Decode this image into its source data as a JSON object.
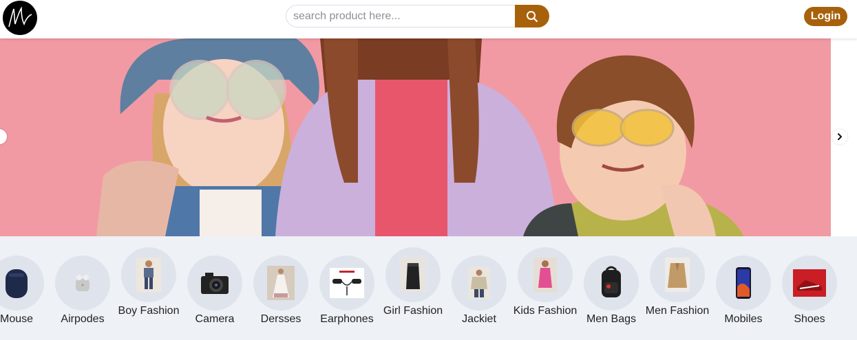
{
  "header": {
    "logo_icon": "signature-logo-icon",
    "search": {
      "placeholder": "search product here...",
      "value": "",
      "button_icon": "search-icon"
    },
    "login_label": "Login",
    "accent_color": "#a8610b"
  },
  "banner": {
    "image": "kids-fashion-banner-photo",
    "background_color": "#f29aa3",
    "prev_icon": "chevron-left-icon",
    "next_icon": "chevron-right-icon"
  },
  "categories": [
    {
      "label": "Mouse",
      "icon": "mouse-product-icon"
    },
    {
      "label": "Airpodes",
      "icon": "airpods-product-icon"
    },
    {
      "label": "Boy Fashion",
      "icon": "boy-fashion-product-icon"
    },
    {
      "label": "Camera",
      "icon": "camera-product-icon"
    },
    {
      "label": "Dersses",
      "icon": "dress-product-icon"
    },
    {
      "label": "Earphones",
      "icon": "earphones-product-icon"
    },
    {
      "label": "Girl Fashion",
      "icon": "girl-fashion-product-icon"
    },
    {
      "label": "Jackiet",
      "icon": "jacket-product-icon"
    },
    {
      "label": "Kids Fashion",
      "icon": "kids-fashion-product-icon"
    },
    {
      "label": "Men Bags",
      "icon": "backpack-product-icon"
    },
    {
      "label": "Men Fashion",
      "icon": "men-fashion-product-icon"
    },
    {
      "label": "Mobiles",
      "icon": "mobile-phone-product-icon"
    },
    {
      "label": "Shoes",
      "icon": "shoe-product-icon"
    }
  ]
}
